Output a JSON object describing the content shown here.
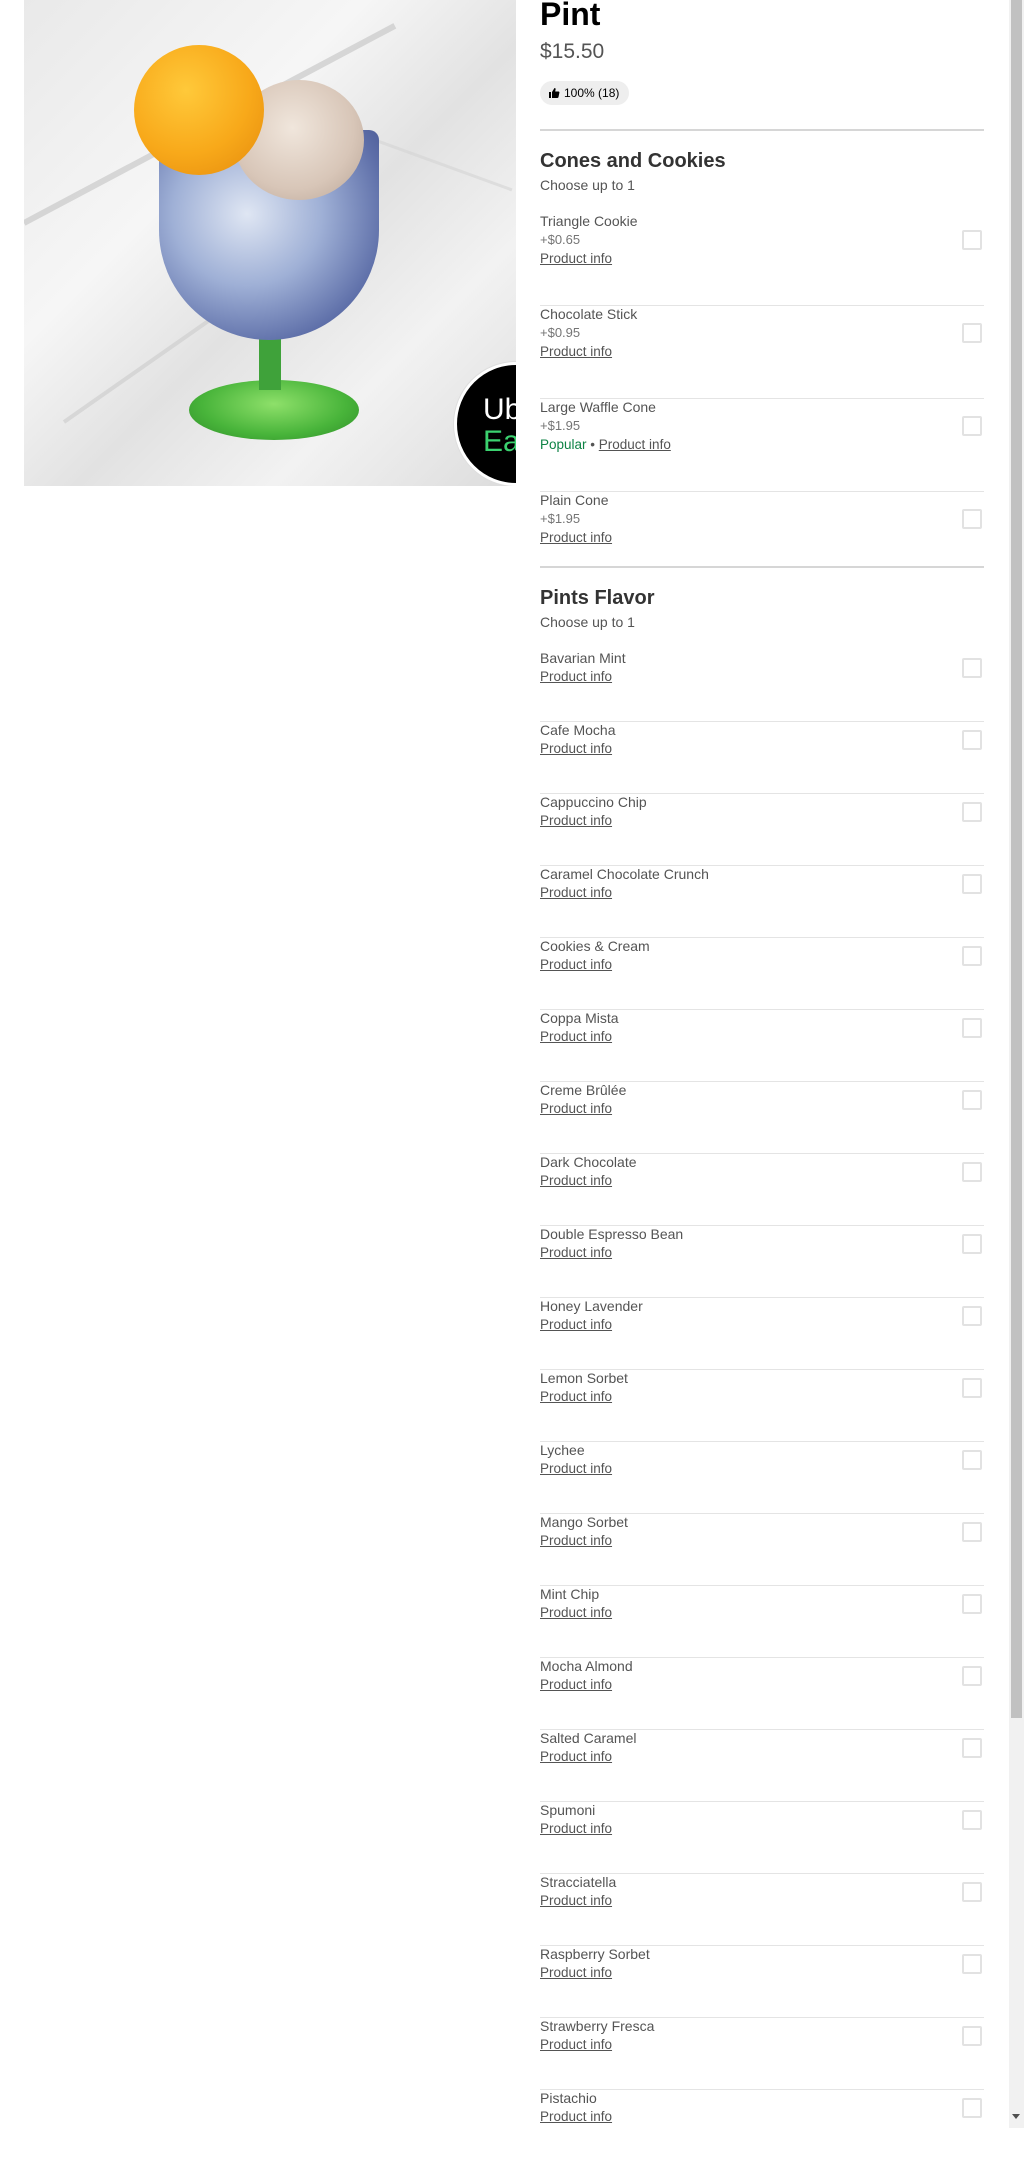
{
  "item": {
    "title": "Pint",
    "price": "$15.50",
    "rating": "100% (18)",
    "image_badge": {
      "line1": "Ub",
      "line2": "Ea"
    }
  },
  "groups": [
    {
      "title": "Cones and Cookies",
      "subtitle": "Choose up to 1",
      "options": [
        {
          "name": "Triangle Cookie",
          "price": "+$0.65",
          "popular": "",
          "info": "Product info"
        },
        {
          "name": "Chocolate Stick",
          "price": "+$0.95",
          "popular": "",
          "info": "Product info"
        },
        {
          "name": "Large Waffle Cone",
          "price": "+$1.95",
          "popular": "Popular",
          "info": "Product info"
        },
        {
          "name": "Plain Cone",
          "price": "+$1.95",
          "popular": "",
          "info": "Product info"
        }
      ]
    },
    {
      "title": "Pints Flavor",
      "subtitle": "Choose up to 1",
      "options": [
        {
          "name": "Bavarian Mint",
          "info": "Product info"
        },
        {
          "name": "Cafe Mocha",
          "info": "Product info"
        },
        {
          "name": "Cappuccino Chip",
          "info": "Product info"
        },
        {
          "name": "Caramel Chocolate Crunch",
          "info": "Product info"
        },
        {
          "name": "Cookies & Cream",
          "info": "Product info"
        },
        {
          "name": "Coppa Mista",
          "info": "Product info"
        },
        {
          "name": "Creme Brûlée",
          "info": "Product info"
        },
        {
          "name": "Dark Chocolate",
          "info": "Product info"
        },
        {
          "name": "Double Espresso Bean",
          "info": "Product info"
        },
        {
          "name": "Honey Lavender",
          "info": "Product info"
        },
        {
          "name": "Lemon Sorbet",
          "info": "Product info"
        },
        {
          "name": "Lychee",
          "info": "Product info"
        },
        {
          "name": "Mango Sorbet",
          "info": "Product info"
        },
        {
          "name": "Mint Chip",
          "info": "Product info"
        },
        {
          "name": "Mocha Almond",
          "info": "Product info"
        },
        {
          "name": "Salted Caramel",
          "info": "Product info"
        },
        {
          "name": "Spumoni",
          "info": "Product info"
        },
        {
          "name": "Stracciatella",
          "info": "Product info"
        },
        {
          "name": "Raspberry Sorbet",
          "info": "Product info"
        },
        {
          "name": "Strawberry Fresca",
          "info": "Product info"
        },
        {
          "name": "Pistachio",
          "info": "Product info"
        }
      ]
    }
  ],
  "colors": {
    "popular": "#0e8345",
    "divider": "#d6d6d6",
    "text_secondary": "#545454"
  },
  "icons": {
    "rating": "thumbs-up-icon",
    "checkbox": "checkbox-icon"
  }
}
